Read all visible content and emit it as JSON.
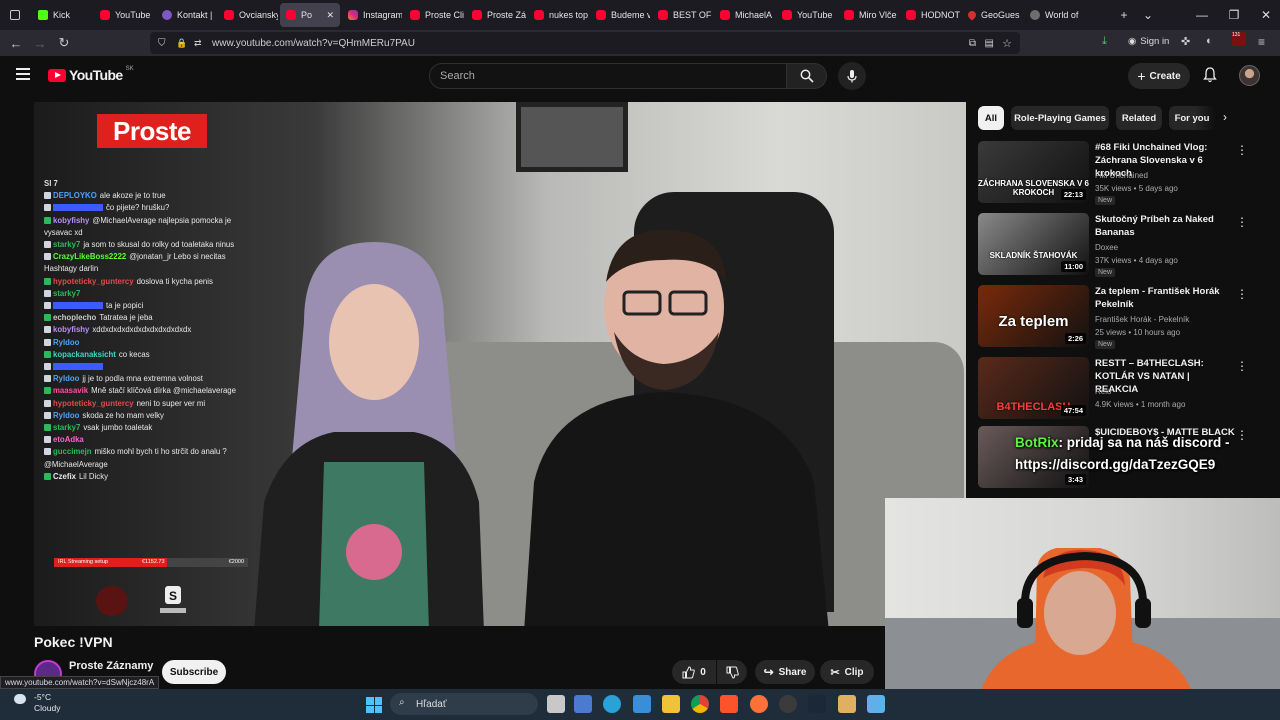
{
  "browser": {
    "tabs": [
      {
        "label": "",
        "icon": "tab-overview-icon"
      },
      {
        "label": "Kick",
        "icon": "kick-icon"
      },
      {
        "label": "YouTube",
        "icon": "youtube-icon"
      },
      {
        "label": "Kontakt | ",
        "icon": "contact-icon"
      },
      {
        "label": "Ovciansky",
        "icon": "youtube-icon"
      },
      {
        "label": "Po",
        "icon": "youtube-icon",
        "active": true
      },
      {
        "label": "Instagram",
        "icon": "instagram-icon"
      },
      {
        "label": "Proste Cli",
        "icon": "youtube-icon"
      },
      {
        "label": "Proste Zá",
        "icon": "youtube-icon"
      },
      {
        "label": "nukes top",
        "icon": "youtube-icon"
      },
      {
        "label": "Budeme v",
        "icon": "youtube-icon"
      },
      {
        "label": "BEST OF F",
        "icon": "youtube-icon"
      },
      {
        "label": "MichaelA",
        "icon": "youtube-icon"
      },
      {
        "label": "YouTube",
        "icon": "youtube-icon"
      },
      {
        "label": "Miro Vlče",
        "icon": "youtube-icon"
      },
      {
        "label": "HODNOT",
        "icon": "youtube-icon"
      },
      {
        "label": "GeoGues",
        "icon": "geoguessr-icon"
      },
      {
        "label": "World of ",
        "icon": "wikipedia-icon"
      }
    ],
    "url": "www.youtube.com/watch?v=QHmMERu7PAU",
    "sign_in": "Sign in",
    "badge_count": "131"
  },
  "youtube": {
    "logo_text": "YouTube",
    "region": "SK",
    "search_placeholder": "Search",
    "create_label": "Create"
  },
  "video": {
    "brand": "Proste",
    "title": "Pokec !VPN",
    "channel": "Proste Záznamy",
    "subscribe": "Subscribe",
    "likes": "0",
    "share": "Share",
    "clip": "Clip",
    "chat": [
      {
        "user": "SI 7",
        "msg": "",
        "color": "#dddddd"
      },
      {
        "user": "DEPLOYKO",
        "msg": "ale akoze je to true",
        "color": "#4aa3ff"
      },
      {
        "user": "",
        "msg": "čo pijete? hrušku?",
        "color": "#3b5bff"
      },
      {
        "user": "kobyfishy",
        "msg": "@MichaelAverage najlepsia pomocka je vysavac xd",
        "color": "#bb8cff"
      },
      {
        "user": "starky7",
        "msg": "ja som to skusal do rolky od toaletaka ninus",
        "color": "#2fb85a"
      },
      {
        "user": "CrazyLikeBoss2222",
        "msg": "@jonatan_jr Lebo si necitas Hashtagy darlin",
        "color": "#5dff2f"
      },
      {
        "user": "hypoteticky_guntercy",
        "msg": "doslova ti kycha penis",
        "color": "#e24a4a"
      },
      {
        "user": "starky7",
        "msg": "",
        "color": "#2fb85a"
      },
      {
        "user": "",
        "msg": "ta je popici",
        "color": "#3b5bff"
      },
      {
        "user": "echoplecho",
        "msg": "Tatratea je jeba",
        "color": "#c9c9c9"
      },
      {
        "user": "kobyfishy",
        "msg": "xddxdxdxdxdxdxdxdxdxdxdx",
        "color": "#bb8cff"
      },
      {
        "user": "Ryldoo",
        "msg": "",
        "color": "#4aa3ff"
      },
      {
        "user": "kopackanaksicht",
        "msg": "co kecas",
        "color": "#3fd7c7"
      },
      {
        "user": "",
        "msg": "",
        "color": "#3b5bff"
      },
      {
        "user": "Ryldoo",
        "msg": "jj je to podla mna extremna volnost",
        "color": "#4aa3ff"
      },
      {
        "user": "maasavik",
        "msg": "Mně stačí klíčová dírka @michaelaverage",
        "color": "#ff4fa3"
      },
      {
        "user": "hypoteticky_guntercy",
        "msg": "neni to super ver mi",
        "color": "#e24a4a"
      },
      {
        "user": "Ryldoo",
        "msg": "skoda ze ho mam velky",
        "color": "#4aa3ff"
      },
      {
        "user": "starky7",
        "msg": "vsak jumbo toaletak",
        "color": "#2fb85a"
      },
      {
        "user": "etoAdka",
        "msg": "",
        "color": "#ff5fd0"
      },
      {
        "user": "guccimejn",
        "msg": "miško mohl bych ti ho strčit do analu ? @MichaelAverage",
        "color": "#2fb85a"
      },
      {
        "user": "Czefix",
        "msg": "Lil Dicky",
        "color": "#e9e9e9"
      }
    ],
    "goal": {
      "label": "IRL Streaming setup",
      "current": "€1152.73",
      "target": "€2000",
      "fraction": 0.58
    }
  },
  "sidebar": {
    "chips": [
      {
        "label": "All",
        "active": true
      },
      {
        "label": "Role-Playing Games"
      },
      {
        "label": "Related"
      },
      {
        "label": "For you"
      }
    ],
    "recommendations": [
      {
        "title": "#68 Fiki Unchained Vlog: Záchrana Slovenska v 6 krokoch",
        "channel": "Fiki Unchained",
        "meta": "35K views • 5 days ago",
        "badge": "New",
        "duration": "22:13",
        "thumb_text": "ZÁCHRANA SLOVENSKA V 6 KROKOCH",
        "thumb_color": "#3a3a3a"
      },
      {
        "title": "Skutočný Príbeh za Naked Bananas",
        "channel": "Doxee",
        "meta": "37K views • 4 days ago",
        "badge": "New",
        "duration": "11:00",
        "thumb_text": "SKLADNÍK   ŠTAHOVÁK",
        "thumb_color": "#8a8a8a"
      },
      {
        "title": "Za teplem  -  František Horák Pekelník",
        "channel": "František Horák - Pekelník",
        "meta": "25 views • 10 hours ago",
        "badge": "New",
        "duration": "2:26",
        "thumb_text": "Za teplem",
        "thumb_color": "#7a2a0a"
      },
      {
        "title": "RESTT – B4THECLASH: KOTLÁR VS NATAN | REAKCIA",
        "channel": "Relo",
        "meta": "4.9K views • 1 month ago",
        "badge": "",
        "duration": "47:54",
        "thumb_text": "B4THECLASH",
        "thumb_color": "#5a2a1a"
      },
      {
        "title": "$UICIDEBOY$ - MATTE BLACK",
        "channel": "",
        "meta": "",
        "badge": "",
        "duration": "3:43",
        "thumb_text": "",
        "thumb_color": "#6a5a5a"
      }
    ]
  },
  "overlay": {
    "name": "BotRix",
    "message": ": pridaj sa na náš discord -",
    "link": "https://discord.gg/daTzezGQE9"
  },
  "status_url": "www.youtube.com/watch?v=dSwNjcz48rA",
  "taskbar": {
    "temperature": "-5°C",
    "weather": "Cloudy",
    "search_placeholder": "Hľadať"
  }
}
